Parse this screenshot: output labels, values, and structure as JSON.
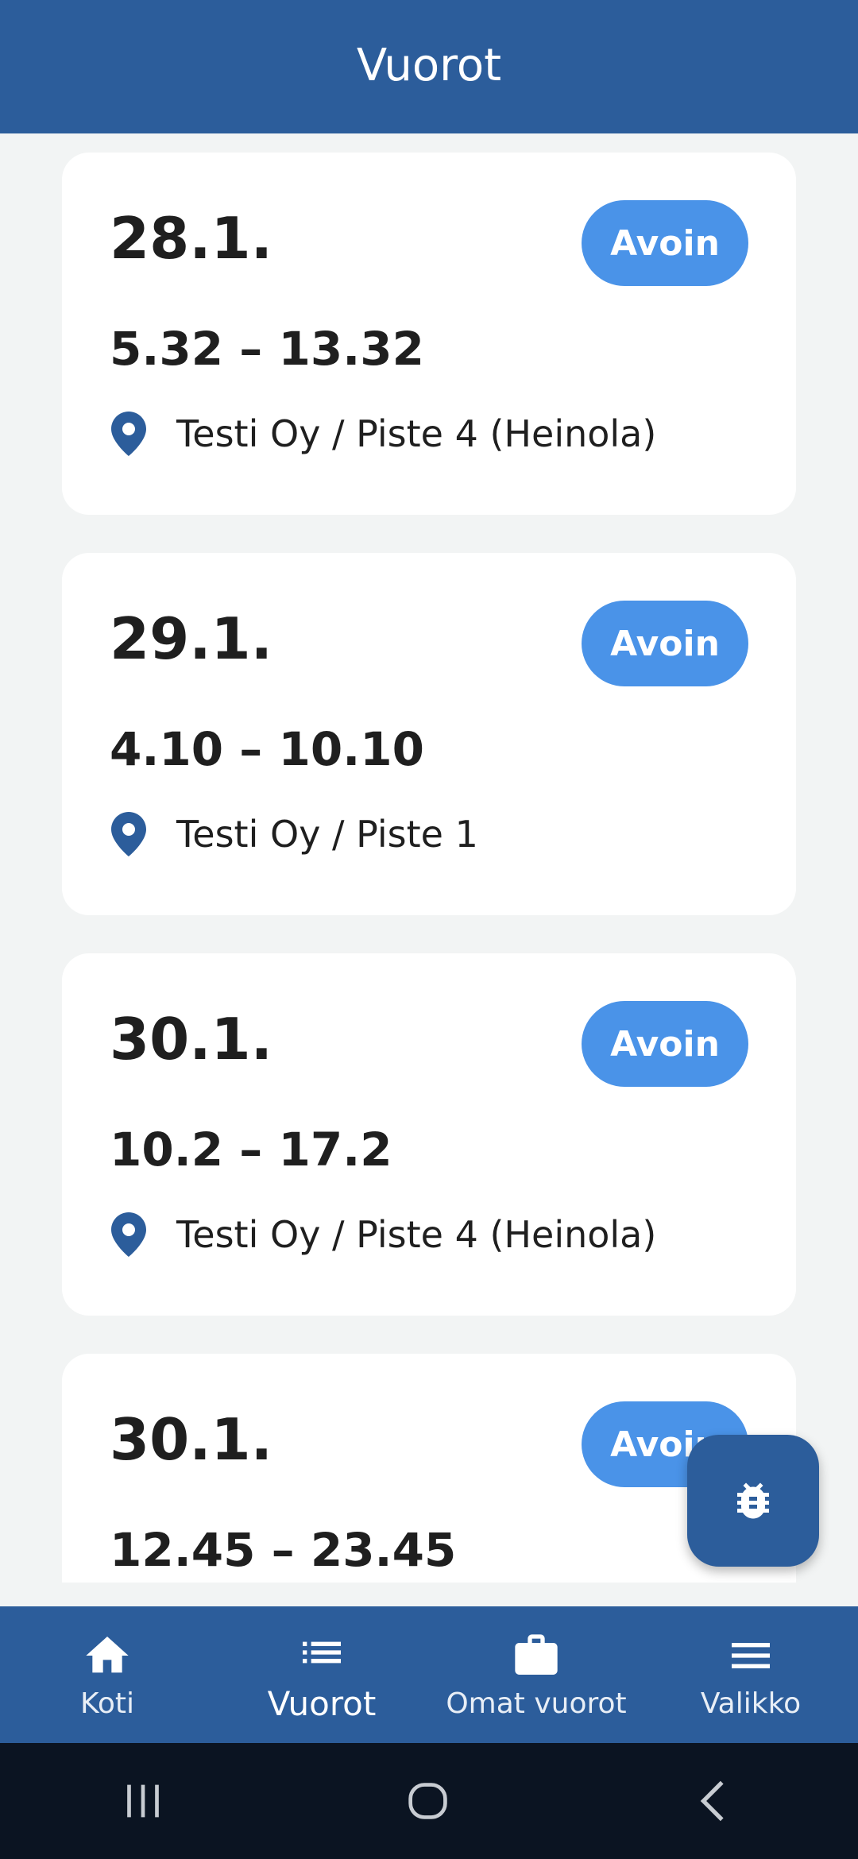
{
  "header": {
    "title": "Vuorot"
  },
  "shifts": [
    {
      "date": "28.1.",
      "status": "Avoin",
      "time": "5.32 – 13.32",
      "location": "Testi Oy / Piste 4 (Heinola)"
    },
    {
      "date": "29.1.",
      "status": "Avoin",
      "time": "4.10 – 10.10",
      "location": "Testi Oy / Piste 1"
    },
    {
      "date": "30.1.",
      "status": "Avoin",
      "time": "10.2 – 17.2",
      "location": "Testi Oy / Piste 4 (Heinola)"
    },
    {
      "date": "30.1.",
      "status": "Avoin",
      "time": "12.45 – 23.45",
      "location": ""
    }
  ],
  "fab": {
    "icon": "bug-icon"
  },
  "bottom_nav": {
    "items": [
      {
        "label": "Koti",
        "icon": "home-icon"
      },
      {
        "label": "Vuorot",
        "icon": "list-icon",
        "active": true
      },
      {
        "label": "Omat vuorot",
        "icon": "briefcase-icon"
      },
      {
        "label": "Valikko",
        "icon": "menu-icon"
      }
    ]
  },
  "colors": {
    "primary": "#2c5d9b",
    "badge": "#4a93e8",
    "background": "#f2f4f4"
  }
}
